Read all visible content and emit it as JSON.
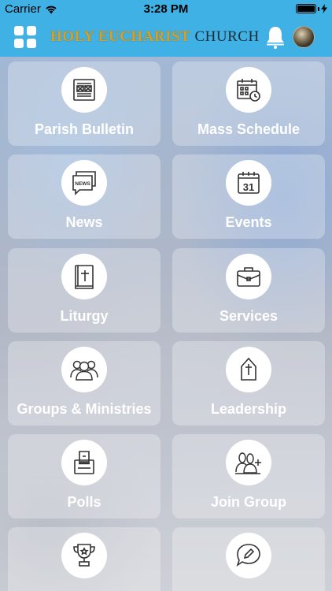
{
  "status_bar": {
    "carrier": "Carrier",
    "time": "3:28 PM"
  },
  "header": {
    "title_part1": "HOLY EUCHARIST",
    "title_part2": "CHURCH",
    "icons": [
      "grid-menu-icon",
      "bell-icon",
      "profile-avatar"
    ]
  },
  "colors": {
    "header_bg": "#3fb1e5",
    "title_gold": "#d4a02b",
    "tile_label": "#ffffff"
  },
  "tiles": [
    {
      "label": "Parish Bulletin",
      "icon": "newspaper-icon"
    },
    {
      "label": "Mass Schedule",
      "icon": "calendar-clock-icon"
    },
    {
      "label": "News",
      "icon": "news-bubble-icon"
    },
    {
      "label": "Events",
      "icon": "calendar-31-icon"
    },
    {
      "label": "Liturgy",
      "icon": "bible-icon"
    },
    {
      "label": "Services",
      "icon": "briefcase-icon"
    },
    {
      "label": "Groups & Ministries",
      "icon": "group-icon"
    },
    {
      "label": "Leadership",
      "icon": "mitre-icon"
    },
    {
      "label": "Polls",
      "icon": "ballot-box-icon"
    },
    {
      "label": "Join Group",
      "icon": "join-group-icon"
    },
    {
      "label": "",
      "icon": "trophy-icon"
    },
    {
      "label": "",
      "icon": "chat-pencil-icon"
    }
  ]
}
